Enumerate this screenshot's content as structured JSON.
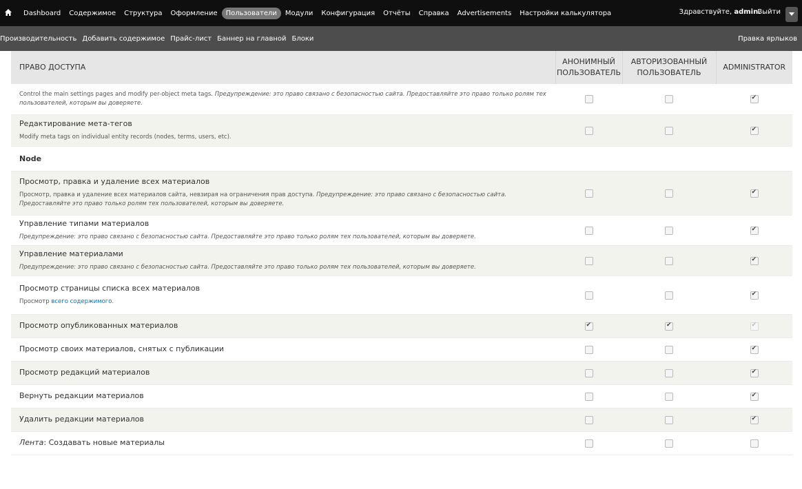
{
  "toolbar": {
    "home_icon": "home-icon",
    "items": [
      "Dashboard",
      "Содержимое",
      "Структура",
      "Оформление",
      "Пользователи",
      "Модули",
      "Конфигурация",
      "Отчёты",
      "Справка",
      "Advertisements",
      "Настройки калькулятора"
    ],
    "active_index": 4,
    "greeting": "Здравствуйте,",
    "username": "admin.",
    "logout": "Выйти",
    "dropdown_icon": "chevron-down-icon"
  },
  "shortcuts": {
    "items": [
      "Производительность",
      "Добавить содержимое",
      "Прайс-лист",
      "Баннер на главной",
      "Блоки"
    ],
    "edit_label": "Правка ярлыков"
  },
  "table": {
    "header": {
      "permission": "ПРАВО ДОСТУПА",
      "roles": [
        "АНОНИМНЫЙ\nПОЛЬЗОВАТЕЛЬ",
        "АВТОРИЗОВАННЫЙ\nПОЛЬЗОВАТЕЛЬ",
        "ADMINISTRATOR"
      ]
    },
    "rows": [
      {
        "type": "perm",
        "title": "",
        "desc_plain": "Control the main settings pages and modify per-object meta tags. ",
        "desc_warn": "Предупреждение: это право связано с безопасностью сайта. Предоставляйте это право только ролям тех пользователей, которым вы доверяете.",
        "checks": [
          false,
          false,
          true
        ],
        "disabled": [
          false,
          false,
          false
        ],
        "shade": "even"
      },
      {
        "type": "perm",
        "title": "Редактирование мета-тегов",
        "desc_plain": "Modify meta tags on individual entity records (nodes, terms, users, etc).",
        "desc_warn": "",
        "checks": [
          false,
          false,
          true
        ],
        "disabled": [
          false,
          false,
          false
        ],
        "shade": "odd"
      },
      {
        "type": "module",
        "title": "Node"
      },
      {
        "type": "perm",
        "title": "Просмотр, правка и удаление всех материалов",
        "desc_plain": "Просмотр, правка и удаление всех материалов сайта, невзирая на ограничения прав доступа. ",
        "desc_warn": "Предупреждение: это право связано с безопасностью сайта. Предоставляйте это право только ролям тех пользователей, которым вы доверяете.",
        "checks": [
          false,
          false,
          true
        ],
        "disabled": [
          false,
          false,
          false
        ],
        "shade": "odd"
      },
      {
        "type": "perm",
        "title": "Управление типами материалов",
        "desc_plain": "",
        "desc_warn": "Предупреждение: это право связано с безопасностью сайта. Предоставляйте это право только ролям тех пользователей, которым вы доверяете.",
        "checks": [
          false,
          false,
          true
        ],
        "disabled": [
          false,
          false,
          false
        ],
        "shade": "even"
      },
      {
        "type": "perm",
        "title": "Управление материалами",
        "desc_plain": "",
        "desc_warn": "Предупреждение: это право связано с безопасностью сайта. Предоставляйте это право только ролям тех пользователей, которым вы доверяете.",
        "checks": [
          false,
          false,
          true
        ],
        "disabled": [
          false,
          false,
          false
        ],
        "shade": "odd"
      },
      {
        "type": "perm",
        "title": "Просмотр страницы списка всех материалов",
        "desc_plain": "Просмотр ",
        "desc_link": "всего содержимого",
        "desc_after": ".",
        "desc_warn": "",
        "checks": [
          false,
          false,
          true
        ],
        "disabled": [
          false,
          false,
          false
        ],
        "shade": "even"
      },
      {
        "type": "perm",
        "title": "Просмотр опубликованных материалов",
        "desc_plain": "",
        "desc_warn": "",
        "checks": [
          true,
          true,
          true
        ],
        "disabled": [
          false,
          false,
          true
        ],
        "shade": "odd"
      },
      {
        "type": "perm",
        "title": "Просмотр своих материалов, снятых с публикации",
        "desc_plain": "",
        "desc_warn": "",
        "checks": [
          false,
          false,
          true
        ],
        "disabled": [
          false,
          false,
          false
        ],
        "shade": "even"
      },
      {
        "type": "perm",
        "title": "Просмотр редакций материалов",
        "desc_plain": "",
        "desc_warn": "",
        "checks": [
          false,
          false,
          true
        ],
        "disabled": [
          false,
          false,
          false
        ],
        "shade": "odd"
      },
      {
        "type": "perm",
        "title": "Вернуть редакции материалов",
        "desc_plain": "",
        "desc_warn": "",
        "checks": [
          false,
          false,
          true
        ],
        "disabled": [
          false,
          false,
          false
        ],
        "shade": "even"
      },
      {
        "type": "perm",
        "title": "Удалить редакции материалов",
        "desc_plain": "",
        "desc_warn": "",
        "checks": [
          false,
          false,
          true
        ],
        "disabled": [
          false,
          false,
          false
        ],
        "shade": "odd"
      },
      {
        "type": "perm",
        "title_prefix": "Лента",
        "title": ": Создавать новые материалы",
        "desc_plain": "",
        "desc_warn": "",
        "checks": [
          false,
          false,
          false
        ],
        "disabled": [
          false,
          false,
          false
        ],
        "shade": "even"
      }
    ]
  }
}
